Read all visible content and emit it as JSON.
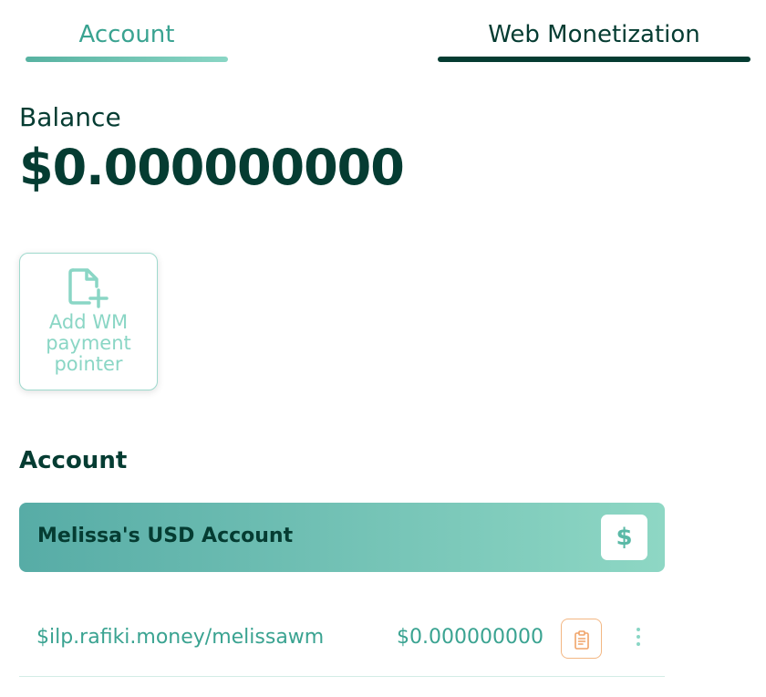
{
  "tabs": {
    "account": "Account",
    "web_monetization": "Web Monetization",
    "active": "account"
  },
  "balance": {
    "label": "Balance",
    "value": "$0.000000000"
  },
  "add_card": {
    "label": "Add WM payment pointer",
    "icon": "file-plus-icon"
  },
  "section": {
    "title": "Account"
  },
  "account": {
    "name": "Melissa's USD Account",
    "badge": "$"
  },
  "payment_pointer": {
    "url": "$ilp.rafiki.money/melissawm",
    "balance": "$0.000000000",
    "copy_icon": "clipboard-icon",
    "menu_icon": "kebab-menu-icon"
  },
  "colors": {
    "primary_dark": "#053c32",
    "teal": "#3aa391",
    "teal_light": "#8ad6c5",
    "copy_accent": "#f3b783"
  }
}
